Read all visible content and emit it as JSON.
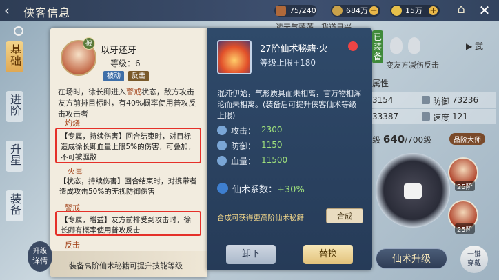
{
  "header": {
    "title": "侠客信息",
    "resources": [
      {
        "icon": "chest-icon",
        "value": "75/240"
      },
      {
        "icon": "coin-icon",
        "value": "684万"
      },
      {
        "icon": "cloud-coin-icon",
        "value": "15万"
      }
    ],
    "weather": "读天气荡荡，我道日兴"
  },
  "tabs": [
    "基础",
    "进阶",
    "升星",
    "装备"
  ],
  "skill": {
    "name": "以牙还牙",
    "badge": "被",
    "level_label": "等级：",
    "level": "6",
    "tags": [
      "被动",
      "反击"
    ],
    "desc_pre": "在场时，徐长卿进入",
    "desc_hl": "警戒",
    "desc_post": "状态，敌方攻击友方前排目标时，有40%概率使用普攻反击攻击者",
    "effects": [
      {
        "title": "灼烧",
        "text": "【专属，持续伤害】回合结束时，对目标造成徐长卿血量上限5%的伤害，可叠加，不可被驱散"
      },
      {
        "title": "火毒",
        "text": "【状态，持续伤害】回合结束时，对携带者造成攻击50%的无视防御伤害"
      },
      {
        "title": "警戒",
        "text": "【专属，增益】友方前排受到攻击时，徐长卿有概率使用普攻反击"
      },
      {
        "title": "反击",
        "text": ""
      }
    ],
    "bottom_note": "装备高阶仙术秘籍可提升技能等级",
    "detail_label": "详情",
    "detail_up": "升级"
  },
  "item": {
    "name": "27阶仙术秘籍·火",
    "sub": "等级上限+180",
    "desc": "混沌伊始，气形质具而未相离，言万物相浑沦而未相离。(装备后可提升侠客仙术等级上限)",
    "stats": [
      {
        "label": "攻击：",
        "value": "2300",
        "icon": "sword-icon"
      },
      {
        "label": "防御：",
        "value": "1150",
        "icon": "shield-icon"
      },
      {
        "label": "血量：",
        "value": "11500",
        "icon": "heart-icon"
      }
    ],
    "coef_label": "仙术系数：",
    "coef_value": "+30%",
    "craft_note": "合成可获得更高阶仙术秘籍",
    "craft_btn": "合成",
    "unequip_btn": "卸下",
    "swap_btn": "替换"
  },
  "right": {
    "equipped_label": "已装备",
    "weapon_label": "武",
    "desc": "变友方减伤反击",
    "attr_title": "属性",
    "attrs": [
      {
        "label": "",
        "value": "3154"
      },
      {
        "label": "防御",
        "value": "73236"
      },
      {
        "label": "",
        "value": "33387"
      },
      {
        "label": "速度",
        "value": "121"
      }
    ],
    "level_prefix": "级",
    "level_value": "640",
    "level_max": "/700级",
    "grade_label": "品阶大师",
    "char1_label": "25阶",
    "char2_label": "25阶",
    "upgrade_btn": "仙术升级",
    "wear_btn_line1": "一键",
    "wear_btn_line2": "穿戴"
  }
}
